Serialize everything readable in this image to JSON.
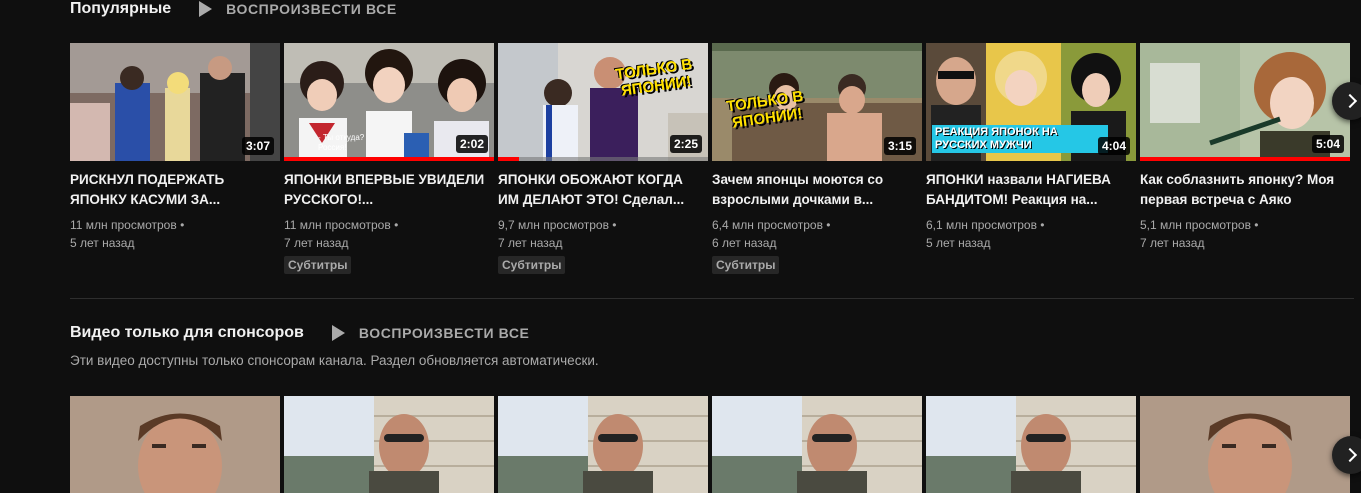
{
  "popular": {
    "title": "Популярные",
    "play_all": "ВОСПРОИЗВЕСТИ ВСЕ",
    "videos": [
      {
        "title": "РИСКНУЛ ПОДЕРЖАТЬ ЯПОНКУ КАСУМИ ЗА...",
        "views": "11 млн просмотров",
        "age": "5 лет назад",
        "duration": "3:07",
        "progress": 0,
        "badge": ""
      },
      {
        "title": "ЯПОНКИ ВПЕРВЫЕ УВИДЕЛИ РУССКОГО!...",
        "views": "11 млн просмотров",
        "age": "7 лет назад",
        "duration": "2:02",
        "progress": 100,
        "badge": "Субтитры",
        "overlay_text": "- Ты откуда?\nРоссия!"
      },
      {
        "title": "ЯПОНКИ ОБОЖАЮТ КОГДА ИМ ДЕЛАЮТ ЭТО! Сделал...",
        "views": "9,7 млн просмотров",
        "age": "7 лет назад",
        "duration": "2:25",
        "progress": 10,
        "badge": "Субтитры",
        "overlay_text": "ТОЛЬКО В ЯПОНИИ!"
      },
      {
        "title": "Зачем японцы моются со взрослыми дочками в...",
        "views": "6,4 млн просмотров",
        "age": "6 лет назад",
        "duration": "3:15",
        "progress": 0,
        "badge": "Субтитры",
        "overlay_text": "ТОЛЬКО В ЯПОНИИ!"
      },
      {
        "title": "ЯПОНКИ назвали НАГИЕВА БАНДИТОМ! Реакция на...",
        "views": "6,1 млн просмотров",
        "age": "5 лет назад",
        "duration": "4:04",
        "progress": 0,
        "badge": "",
        "overlay_text": "РЕАКЦИЯ ЯПОНОК НА РУССКИХ МУЖЧИ"
      },
      {
        "title": "Как соблазнить японку? Моя первая встреча с Аяко",
        "views": "5,1 млн просмотров",
        "age": "7 лет назад",
        "duration": "5:04",
        "progress": 100,
        "badge": ""
      }
    ]
  },
  "sponsors": {
    "title": "Видео только для спонсоров",
    "play_all": "ВОСПРОИЗВЕСТИ ВСЕ",
    "description": "Эти видео доступны только спонсорам канала. Раздел обновляется автоматически."
  },
  "colors": {
    "background": "#0f0f0f",
    "progress": "#ff0000",
    "secondary_text": "#aaaaaa"
  },
  "icons": {
    "play_all": "play-icon",
    "next": "chevron-right-icon"
  }
}
